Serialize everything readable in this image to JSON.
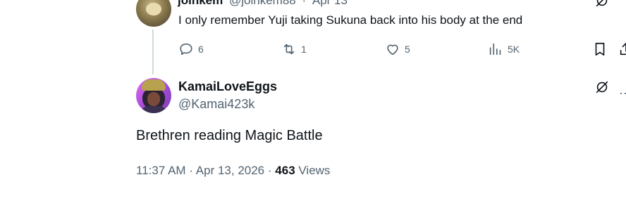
{
  "parent_tweet": {
    "display_name": "joinkem",
    "handle": "@joinkem88",
    "separator": "·",
    "date": "Apr 13",
    "text": "I only remember Yuji taking Sukuna back into his body at the end",
    "actions": {
      "replies": "6",
      "reposts": "1",
      "likes": "5",
      "views": "5K"
    }
  },
  "main_tweet": {
    "display_name": "KamaiLoveEggs",
    "handle": "@Kamai423k",
    "text": "Brethren reading Magic Battle",
    "time": "11:37 AM",
    "separator": "·",
    "date": "Apr 13, 2026",
    "view_count": "463",
    "views_label": "Views"
  },
  "icons": {
    "reply": "reply-icon",
    "repost": "repost-icon",
    "like": "heart-icon",
    "views": "views-chart-icon",
    "bookmark": "bookmark-icon",
    "share": "share-icon",
    "grok": "grok-icon",
    "more": "more-icon"
  },
  "colors": {
    "text_primary": "#0f1419",
    "text_secondary": "#536471",
    "thread_line": "#cfd9de"
  }
}
